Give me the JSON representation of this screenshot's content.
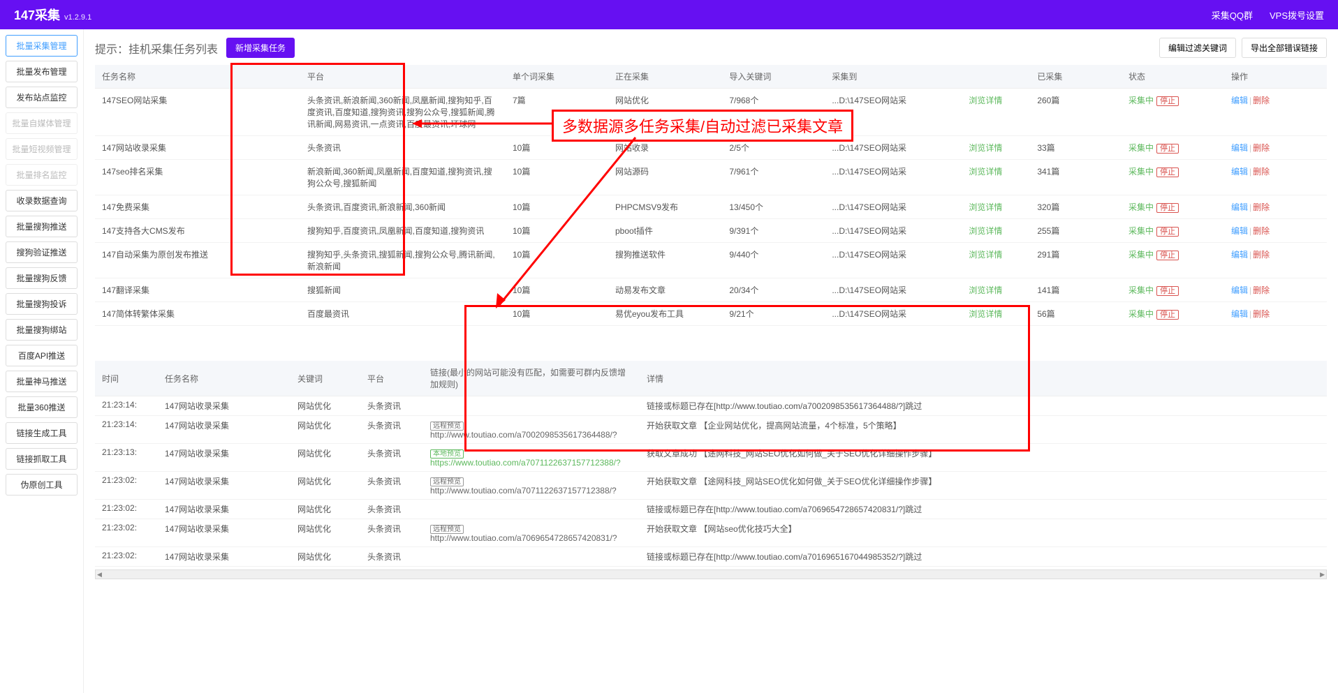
{
  "header": {
    "title": "147采集",
    "version": "v1.2.9.1",
    "link_qq": "采集QQ群",
    "link_vps": "VPS拨号设置"
  },
  "sidebar": {
    "items": [
      {
        "label": "批量采集管理",
        "state": "active"
      },
      {
        "label": "批量发布管理",
        "state": ""
      },
      {
        "label": "发布站点监控",
        "state": ""
      },
      {
        "label": "批量自媒体管理",
        "state": "disabled"
      },
      {
        "label": "批量短视频管理",
        "state": "disabled"
      },
      {
        "label": "批量排名监控",
        "state": "disabled"
      },
      {
        "label": "收录数据查询",
        "state": ""
      },
      {
        "label": "批量搜狗推送",
        "state": ""
      },
      {
        "label": "搜狗验证推送",
        "state": ""
      },
      {
        "label": "批量搜狗反馈",
        "state": ""
      },
      {
        "label": "批量搜狗投诉",
        "state": ""
      },
      {
        "label": "批量搜狗绑站",
        "state": ""
      },
      {
        "label": "百度API推送",
        "state": ""
      },
      {
        "label": "批量神马推送",
        "state": ""
      },
      {
        "label": "批量360推送",
        "state": ""
      },
      {
        "label": "链接生成工具",
        "state": ""
      },
      {
        "label": "链接抓取工具",
        "state": ""
      },
      {
        "label": "伪原创工具",
        "state": ""
      }
    ]
  },
  "panel": {
    "title": "提示：挂机采集任务列表",
    "btn_new": "新增采集任务",
    "btn_filter": "编辑过滤关键词",
    "btn_export": "导出全部错误链接"
  },
  "annotation": "多数据源多任务采集/自动过滤已采集文章",
  "task_table": {
    "headers": [
      "任务名称",
      "平台",
      "单个词采集",
      "正在采集",
      "导入关键词",
      "采集到",
      "",
      "已采集",
      "状态",
      "操作"
    ],
    "browse_label": "浏览详情",
    "stop_label": "停止",
    "edit_label": "编辑",
    "delete_label": "删除",
    "status_label": "采集中",
    "rows": [
      {
        "name": "147SEO网站采集",
        "platform": "头条资讯,新浪新闻,360新闻,凤凰新闻,搜狗知乎,百度资讯,百度知道,搜狗资讯,搜狗公众号,搜狐新闻,腾讯新闻,网易资讯,一点资讯,百度最资讯,环球网",
        "count": "7篇",
        "collecting": "网站优化",
        "keywords": "7/968个",
        "dest": "...D:\\147SEO网站采",
        "collected": "260篇"
      },
      {
        "name": "147网站收录采集",
        "platform": "头条资讯",
        "count": "10篇",
        "collecting": "网站收录",
        "keywords": "2/5个",
        "dest": "...D:\\147SEO网站采",
        "collected": "33篇"
      },
      {
        "name": "147seo排名采集",
        "platform": "新浪新闻,360新闻,凤凰新闻,百度知道,搜狗资讯,搜狗公众号,搜狐新闻",
        "count": "10篇",
        "collecting": "网站源码",
        "keywords": "7/961个",
        "dest": "...D:\\147SEO网站采",
        "collected": "341篇"
      },
      {
        "name": "147免费采集",
        "platform": "头条资讯,百度资讯,新浪新闻,360新闻",
        "count": "10篇",
        "collecting": "PHPCMSV9发布",
        "keywords": "13/450个",
        "dest": "...D:\\147SEO网站采",
        "collected": "320篇"
      },
      {
        "name": "147支持各大CMS发布",
        "platform": "搜狗知乎,百度资讯,凤凰新闻,百度知道,搜狗资讯",
        "count": "10篇",
        "collecting": "pboot插件",
        "keywords": "9/391个",
        "dest": "...D:\\147SEO网站采",
        "collected": "255篇"
      },
      {
        "name": "147自动采集为原创发布推送",
        "platform": "搜狗知乎,头条资讯,搜狐新闻,搜狗公众号,腾讯新闻,新浪新闻",
        "count": "10篇",
        "collecting": "搜狗推送软件",
        "keywords": "9/440个",
        "dest": "...D:\\147SEO网站采",
        "collected": "291篇"
      },
      {
        "name": "147翻译采集",
        "platform": "搜狐新闻",
        "count": "10篇",
        "collecting": "动易发布文章",
        "keywords": "20/34个",
        "dest": "...D:\\147SEO网站采",
        "collected": "141篇"
      },
      {
        "name": "147简体转繁体采集",
        "platform": "百度最资讯",
        "count": "10篇",
        "collecting": "易优eyou发布工具",
        "keywords": "9/21个",
        "dest": "...D:\\147SEO网站采",
        "collected": "56篇"
      }
    ]
  },
  "log_table": {
    "headers": [
      "时间",
      "任务名称",
      "关键词",
      "平台",
      "链接(最小的网站可能没有匹配，如需要可群内反馈增加规则)",
      "详情"
    ],
    "badge_remote": "远程预览",
    "badge_local": "本地预览",
    "rows": [
      {
        "time": "21:23:14:",
        "name": "147网站收录采集",
        "keyword": "网站优化",
        "platform": "头条资讯",
        "link": "",
        "link_type": "",
        "detail": "链接或标题已存在[http://www.toutiao.com/a7002098535617364488/?]跳过"
      },
      {
        "time": "21:23:14:",
        "name": "147网站收录采集",
        "keyword": "网站优化",
        "platform": "头条资讯",
        "link": "http://www.toutiao.com/a7002098535617364488/?",
        "link_type": "remote",
        "detail": "开始获取文章 【企业网站优化，提高网站流量，4个标准，5个策略】"
      },
      {
        "time": "21:23:13:",
        "name": "147网站收录采集",
        "keyword": "网站优化",
        "platform": "头条资讯",
        "link": "https://www.toutiao.com/a7071122637157712388/?",
        "link_type": "local",
        "detail": "获取文章成功 【途网科技_网站SEO优化如何做_关于SEO优化详细操作步骤】"
      },
      {
        "time": "21:23:02:",
        "name": "147网站收录采集",
        "keyword": "网站优化",
        "platform": "头条资讯",
        "link": "http://www.toutiao.com/a7071122637157712388/?",
        "link_type": "remote",
        "detail": "开始获取文章 【途网科技_网站SEO优化如何做_关于SEO优化详细操作步骤】"
      },
      {
        "time": "21:23:02:",
        "name": "147网站收录采集",
        "keyword": "网站优化",
        "platform": "头条资讯",
        "link": "",
        "link_type": "",
        "detail": "链接或标题已存在[http://www.toutiao.com/a7069654728657420831/?]跳过"
      },
      {
        "time": "21:23:02:",
        "name": "147网站收录采集",
        "keyword": "网站优化",
        "platform": "头条资讯",
        "link": "http://www.toutiao.com/a7069654728657420831/?",
        "link_type": "remote",
        "detail": "开始获取文章 【网站seo优化技巧大全】"
      },
      {
        "time": "21:23:02:",
        "name": "147网站收录采集",
        "keyword": "网站优化",
        "platform": "头条资讯",
        "link": "",
        "link_type": "",
        "detail": "链接或标题已存在[http://www.toutiao.com/a7016965167044985352/?]跳过"
      }
    ]
  }
}
